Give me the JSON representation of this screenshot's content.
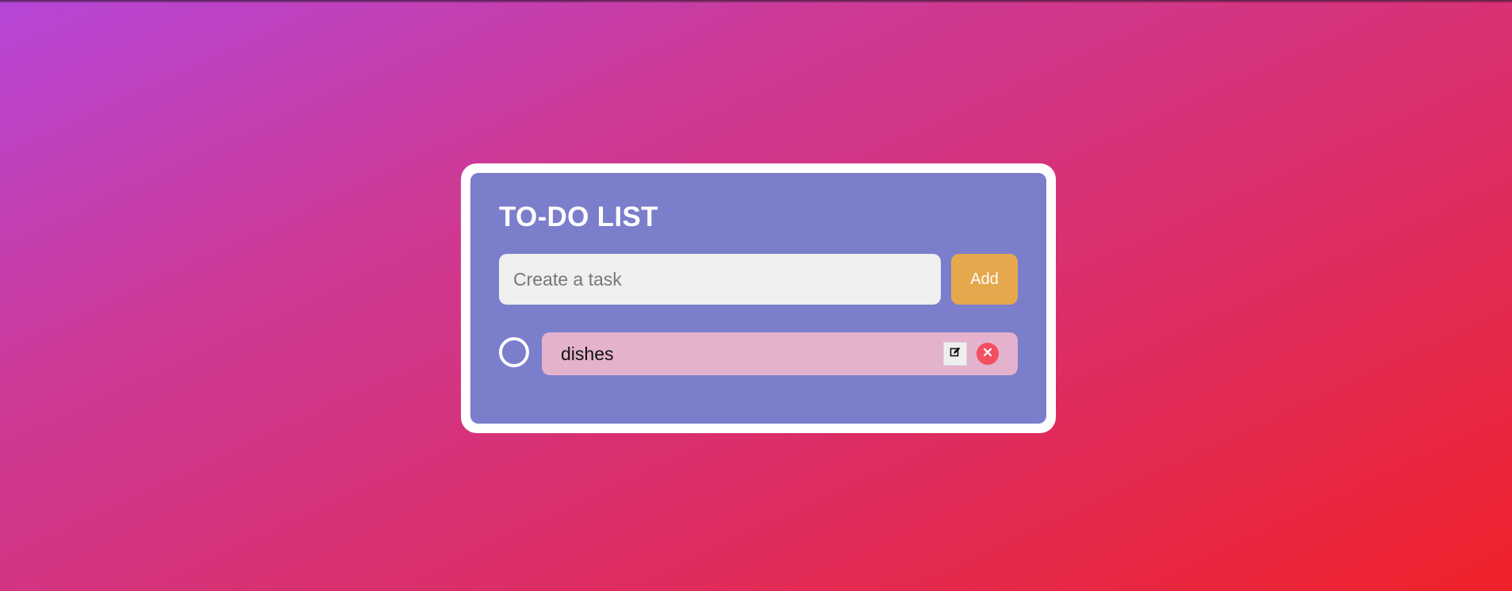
{
  "app": {
    "title": "TO-DO LIST"
  },
  "input": {
    "placeholder": "Create a task",
    "value": ""
  },
  "add_button": {
    "label": "Add"
  },
  "tasks": [
    {
      "text": "dishes",
      "completed": false,
      "edit_icon": "edit-icon",
      "delete_icon": "close-icon"
    }
  ],
  "colors": {
    "card_frame": "#ffffff",
    "card_background": "#7b7ecb",
    "input_background": "#efefef",
    "add_button": "#e6a84d",
    "task_pill": "#e4b2cc",
    "delete_button": "#f2505f",
    "gradient_start": "#b646d8",
    "gradient_end": "#f0222a"
  }
}
